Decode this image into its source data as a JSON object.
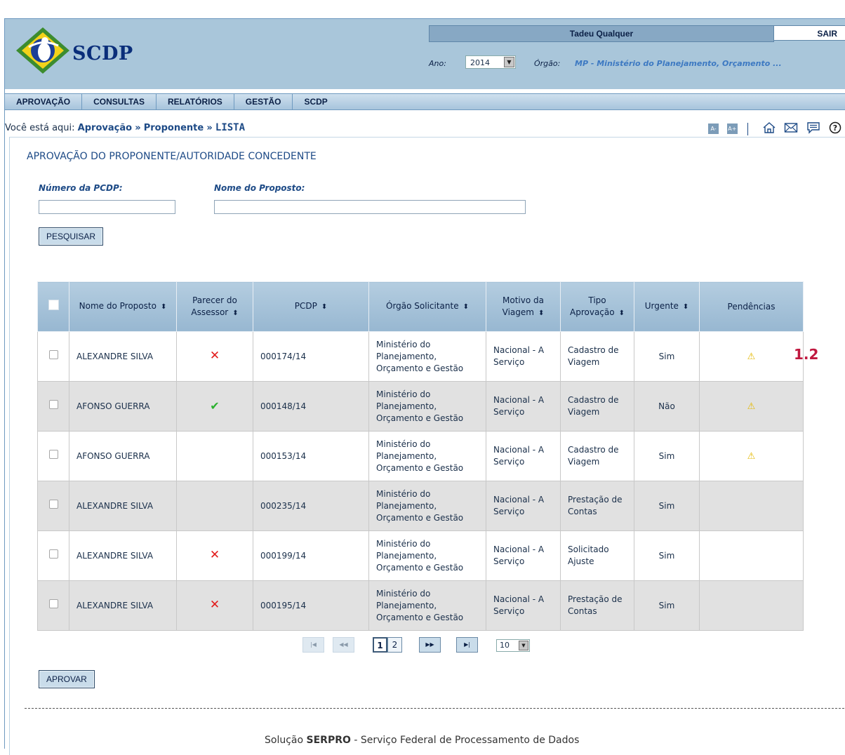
{
  "header": {
    "logo_text": "SCDP",
    "user_name": "Tadeu Qualquer",
    "logout_label": "SAIR",
    "ano_label": "Ano:",
    "ano_value": "2014",
    "orgao_label": "Órgão:",
    "orgao_value": "MP - Ministério do Planejamento, Orçamento ..."
  },
  "nav": [
    "APROVAÇÃO",
    "CONSULTAS",
    "RELATÓRIOS",
    "GESTÃO",
    "SCDP"
  ],
  "breadcrumb": {
    "prefix": "Você está aqui:",
    "items": [
      "Aprovação",
      "Proponente",
      "LISTA"
    ]
  },
  "tools": {
    "font_decrease": "A-",
    "font_increase": "A+",
    "icons": [
      "home-icon",
      "mail-icon",
      "chat-icon",
      "help-icon"
    ]
  },
  "page": {
    "title": "APROVAÇÃO DO PROPONENTE/AUTORIDADE CONCEDENTE",
    "numero_label": "Número da PCDP:",
    "nome_label": "Nome do Proposto:",
    "search_button": "PESQUISAR",
    "approve_button": "APROVAR"
  },
  "table": {
    "columns": [
      "Nome do Proposto",
      "Parecer do Assessor",
      "PCDP",
      "Órgão Solicitante",
      "Motivo da Viagem",
      "Tipo Aprovação",
      "Urgente",
      "Pendências"
    ],
    "rows": [
      {
        "nome": "ALEXANDRE SILVA",
        "parecer": "cross",
        "pcdp": "000174/14",
        "orgao": "Ministério do Planejamento, Orçamento e Gestão",
        "motivo": "Nacional - A Serviço",
        "tipo": "Cadastro de Viagem",
        "urgente": "Sim",
        "pendencia": true
      },
      {
        "nome": "AFONSO GUERRA",
        "parecer": "check",
        "pcdp": "000148/14",
        "orgao": "Ministério do Planejamento, Orçamento e Gestão",
        "motivo": "Nacional - A Serviço",
        "tipo": "Cadastro de Viagem",
        "urgente": "Não",
        "pendencia": true
      },
      {
        "nome": "AFONSO GUERRA",
        "parecer": "",
        "pcdp": "000153/14",
        "orgao": "Ministério do Planejamento, Orçamento e Gestão",
        "motivo": "Nacional - A Serviço",
        "tipo": "Cadastro de Viagem",
        "urgente": "Sim",
        "pendencia": true
      },
      {
        "nome": "ALEXANDRE SILVA",
        "parecer": "",
        "pcdp": "000235/14",
        "orgao": "Ministério do Planejamento, Orçamento e Gestão",
        "motivo": "Nacional - A Serviço",
        "tipo": "Prestação de Contas",
        "urgente": "Sim",
        "pendencia": false
      },
      {
        "nome": "ALEXANDRE SILVA",
        "parecer": "cross",
        "pcdp": "000199/14",
        "orgao": "Ministério do Planejamento, Orçamento e Gestão",
        "motivo": "Nacional - A Serviço",
        "tipo": "Solicitado Ajuste",
        "urgente": "Sim",
        "pendencia": false
      },
      {
        "nome": "ALEXANDRE SILVA",
        "parecer": "cross",
        "pcdp": "000195/14",
        "orgao": "Ministério do Planejamento, Orçamento e Gestão",
        "motivo": "Nacional - A Serviço",
        "tipo": "Prestação de Contas",
        "urgente": "Sim",
        "pendencia": false
      }
    ]
  },
  "annotation": "1.2",
  "pagination": {
    "pages": [
      "1",
      "2"
    ],
    "current": "1",
    "page_size": "10"
  },
  "footer": {
    "prefix": "Solução",
    "company": "SERPRO",
    "suffix": "- Serviço Federal de Processamento de Dados"
  },
  "colors": {
    "header_bg": "#a9c6da",
    "accent": "#1d4a86",
    "cross": "#e21b1b",
    "check": "#2bb12e",
    "warning": "#e4b800",
    "annotation": "#c0183f"
  }
}
